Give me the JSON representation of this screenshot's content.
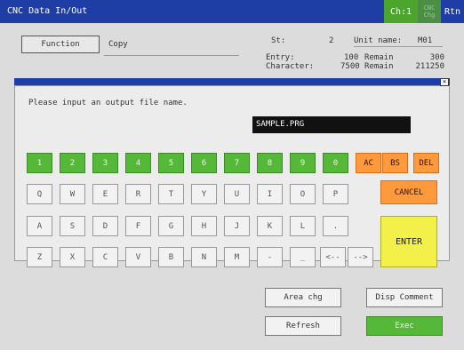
{
  "window": {
    "title": "CNC Data In/Out",
    "ch_label": "Ch:1",
    "cnc_label": "CNC Chg",
    "rtn_label": "Rtn"
  },
  "header": {
    "function_label": "Function",
    "function_value": "Copy",
    "st_label": "St:",
    "st_value": "2",
    "unit_label": "Unit name:",
    "unit_value": "M01",
    "entry_label": "Entry:",
    "entry_count": "100",
    "entry_remain_label": "Remain",
    "entry_remain": "300",
    "char_label": "Character:",
    "char_count": "7500",
    "char_remain_label": "Remain",
    "char_remain": "211250"
  },
  "dialog": {
    "prompt": "Please input an output file name.",
    "filename": "SAMPLE.PRG",
    "close": "×"
  },
  "keys": {
    "row1": [
      "1",
      "2",
      "3",
      "4",
      "5",
      "6",
      "7",
      "8",
      "9",
      "0"
    ],
    "row1_extra": [
      "AC",
      "BS",
      "DEL"
    ],
    "row2": [
      "Q",
      "W",
      "E",
      "R",
      "T",
      "Y",
      "U",
      "I",
      "O",
      "P"
    ],
    "row3": [
      "A",
      "S",
      "D",
      "F",
      "G",
      "H",
      "J",
      "K",
      "L",
      "."
    ],
    "row4": [
      "Z",
      "X",
      "C",
      "V",
      "B",
      "N",
      "M",
      "-",
      "_",
      "<--",
      "-->"
    ],
    "cancel": "CANCEL",
    "enter": "ENTER"
  },
  "bottom": {
    "area_chg": "Area chg",
    "disp_comment": "Disp Comment",
    "refresh": "Refresh",
    "exec": "Exec"
  },
  "colors": {
    "title_bar": "#1e3ea6",
    "green": "#56b838",
    "orange": "#ff9a3c",
    "yellow": "#f3f04a"
  }
}
